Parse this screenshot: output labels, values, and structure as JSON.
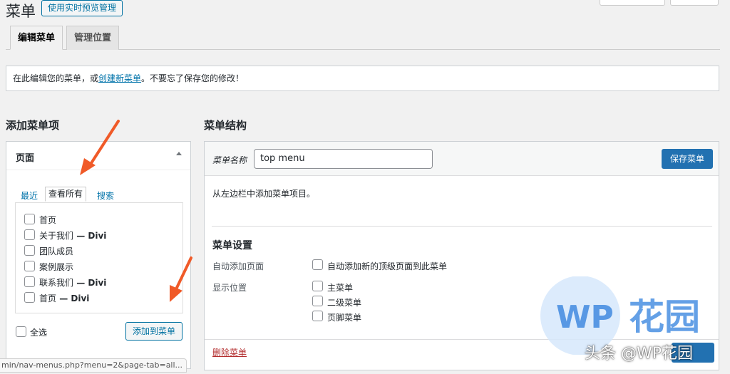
{
  "header": {
    "title": "菜单",
    "live_preview_button": "使用实时预览管理"
  },
  "tabs": [
    {
      "label": "编辑菜单",
      "active": true
    },
    {
      "label": "管理位置",
      "active": false
    }
  ],
  "notice": {
    "prefix": "在此编辑您的菜单，或",
    "link": "创建新菜单",
    "suffix": "。不要忘了保存您的修改！"
  },
  "add_items": {
    "title": "添加菜单项",
    "pages_panel": {
      "title": "页面",
      "tabs": [
        "最近",
        "查看所有",
        "搜索"
      ],
      "active_tab": "查看所有",
      "items": [
        {
          "label": "首页",
          "suffix": ""
        },
        {
          "label": "关于我们",
          "suffix": " — Divi"
        },
        {
          "label": "团队成员",
          "suffix": ""
        },
        {
          "label": "案例展示",
          "suffix": ""
        },
        {
          "label": "联系我们",
          "suffix": " — Divi"
        },
        {
          "label": "首页",
          "suffix": " — Divi"
        }
      ],
      "select_all": "全选",
      "add_button": "添加到菜单"
    }
  },
  "structure": {
    "title": "菜单结构",
    "name_label": "菜单名称",
    "name_value": "top menu",
    "save_button": "保存菜单",
    "hint": "从左边栏中添加菜单项目。",
    "settings_title": "菜单设置",
    "auto_add_label": "自动添加页面",
    "auto_add_option": "自动添加新的顶级页面到此菜单",
    "location_label": "显示位置",
    "locations": [
      "主菜单",
      "二级菜单",
      "页脚菜单"
    ],
    "delete_link": "删除菜单"
  },
  "statusbar": {
    "url": "min/nav-menus.php?menu=2&page-tab=all..."
  },
  "watermark": {
    "logo_text": "WP花园",
    "caption": "头条 @WP花园"
  },
  "colors": {
    "accent": "#2271b1",
    "link": "#0073aa",
    "delete": "#b32d2e",
    "annotation_arrow": "#f05a28"
  }
}
